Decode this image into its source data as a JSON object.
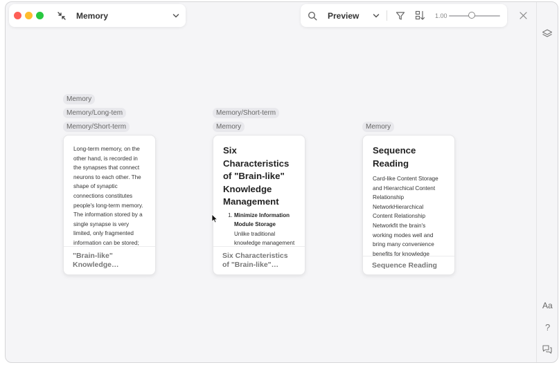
{
  "header": {
    "doc_title": "Memory",
    "mode": "Preview",
    "zoom": "1.00",
    "zoom_level": 0.45
  },
  "sidebar": {
    "font_label": "Aa",
    "help_label": "?"
  },
  "cards": [
    {
      "tags": [
        "Memory",
        "Memory/Long-tem",
        "Memory/Short-term"
      ],
      "body_text": "Long-term memory, on the other hand, is recorded in the synapses that connect neurons to each other. The shape of synaptic connections constitutes people's long-term memory. The information stored by a single synapse is very limited, only fragmented information can be stored; but through many interconnections...",
      "footer": "\"Brain-like\" Knowledge Management"
    },
    {
      "tags": [
        "Memory/Short-term",
        "Memory"
      ],
      "title": "Six Characteristics of \"Brain-like\" Knowledge Management",
      "list_item_title": "Minimize Information Module Storage",
      "list_item_text": "Unlike traditional knowledge management",
      "footer": "Six Characteristics of \"Brain-like\" Knowledge Management"
    },
    {
      "tags": [
        "Memory"
      ],
      "title": "Sequence Reading",
      "body_text": "Card-like Content Storage and  Hierarchical Content Relationship NetworkHierarchical Content Relationship Networkfit the brain's working modes well and bring many convenience benefits for knowledge management, but fragmented information...",
      "footer": "Sequence Reading"
    }
  ],
  "colors": {
    "close_red": "#fe5f57",
    "minimize_yellow": "#febc2e",
    "zoom_green": "#28c840",
    "tag_bg": "#e8e8ec"
  }
}
